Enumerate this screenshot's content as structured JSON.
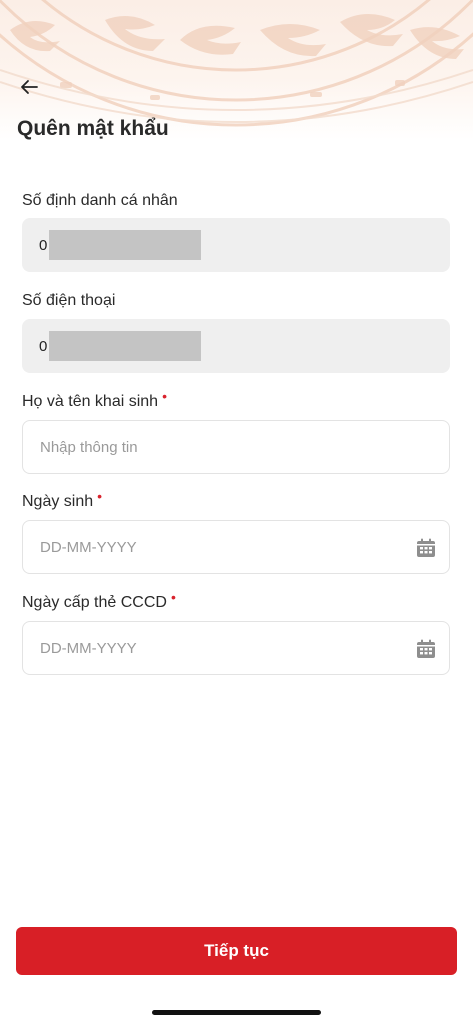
{
  "header": {
    "title": "Quên mật khẩu",
    "back_icon": "arrow-left-icon"
  },
  "form": {
    "personal_id": {
      "label": "Số định danh cá nhân",
      "value_prefix": "0"
    },
    "phone": {
      "label": "Số điện thoại",
      "value_prefix": "0"
    },
    "full_name": {
      "label": "Họ và tên khai sinh",
      "required_mark": "•",
      "placeholder": "Nhập thông tin"
    },
    "birth_date": {
      "label": "Ngày sinh",
      "required_mark": "•",
      "placeholder": "DD-MM-YYYY",
      "icon": "calendar-icon"
    },
    "id_issue_date": {
      "label": "Ngày cấp thẻ CCCD",
      "required_mark": "•",
      "placeholder": "DD-MM-YYYY",
      "icon": "calendar-icon"
    }
  },
  "actions": {
    "continue_label": "Tiếp tục"
  },
  "colors": {
    "accent": "#d81f26",
    "required": "#d9232d",
    "readonly_bg": "#efefef",
    "placeholder": "#9a9a9a"
  }
}
